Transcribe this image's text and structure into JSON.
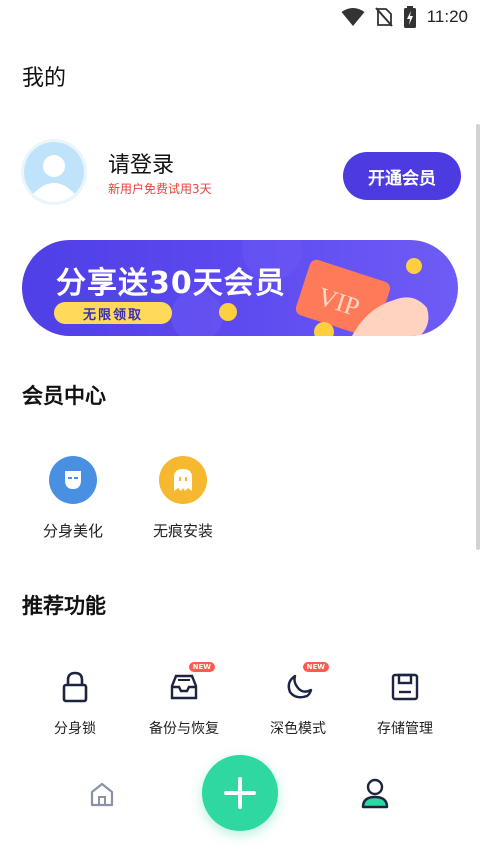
{
  "status_bar": {
    "time": "11:20"
  },
  "page": {
    "title": "我的"
  },
  "profile": {
    "login_title": "请登录",
    "trial_text": "新用户免费试用3天",
    "vip_button": "开通会员"
  },
  "banner": {
    "title": "分享送30天会员",
    "tag": "无限领取",
    "card_text": "VIP"
  },
  "member_center": {
    "title": "会员中心",
    "items": [
      {
        "label": "分身美化",
        "icon": "mask-icon",
        "color": "#4a90e2"
      },
      {
        "label": "无痕安装",
        "icon": "ghost-icon",
        "color": "#f5b82e"
      }
    ]
  },
  "recommended": {
    "title": "推荐功能",
    "items": [
      {
        "label": "分身锁",
        "icon": "lock-icon",
        "badge": ""
      },
      {
        "label": "备份与恢复",
        "icon": "inbox-icon",
        "badge": "NEW"
      },
      {
        "label": "深色模式",
        "icon": "moon-icon",
        "badge": "NEW"
      },
      {
        "label": "存储管理",
        "icon": "save-icon",
        "badge": ""
      }
    ]
  },
  "colors": {
    "accent": "#4b3be0",
    "add_button": "#2fd7a1",
    "warning_text": "#e64340"
  }
}
